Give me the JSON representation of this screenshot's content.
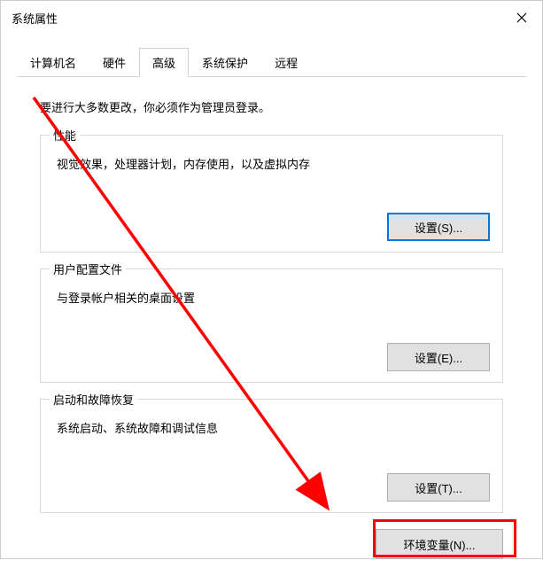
{
  "window": {
    "title": "系统属性"
  },
  "tabs": {
    "computer_name": "计算机名",
    "hardware": "硬件",
    "advanced": "高级",
    "system_protection": "系统保护",
    "remote": "远程"
  },
  "intro": "要进行大多数更改，你必须作为管理员登录。",
  "groups": {
    "performance": {
      "title": "性能",
      "desc": "视觉效果，处理器计划，内存使用，以及虚拟内存",
      "button": "设置(S)..."
    },
    "user_profiles": {
      "title": "用户配置文件",
      "desc": "与登录帐户相关的桌面设置",
      "button": "设置(E)..."
    },
    "startup": {
      "title": "启动和故障恢复",
      "desc": "系统启动、系统故障和调试信息",
      "button": "设置(T)..."
    }
  },
  "env_var_button": "环境变量(N)..."
}
